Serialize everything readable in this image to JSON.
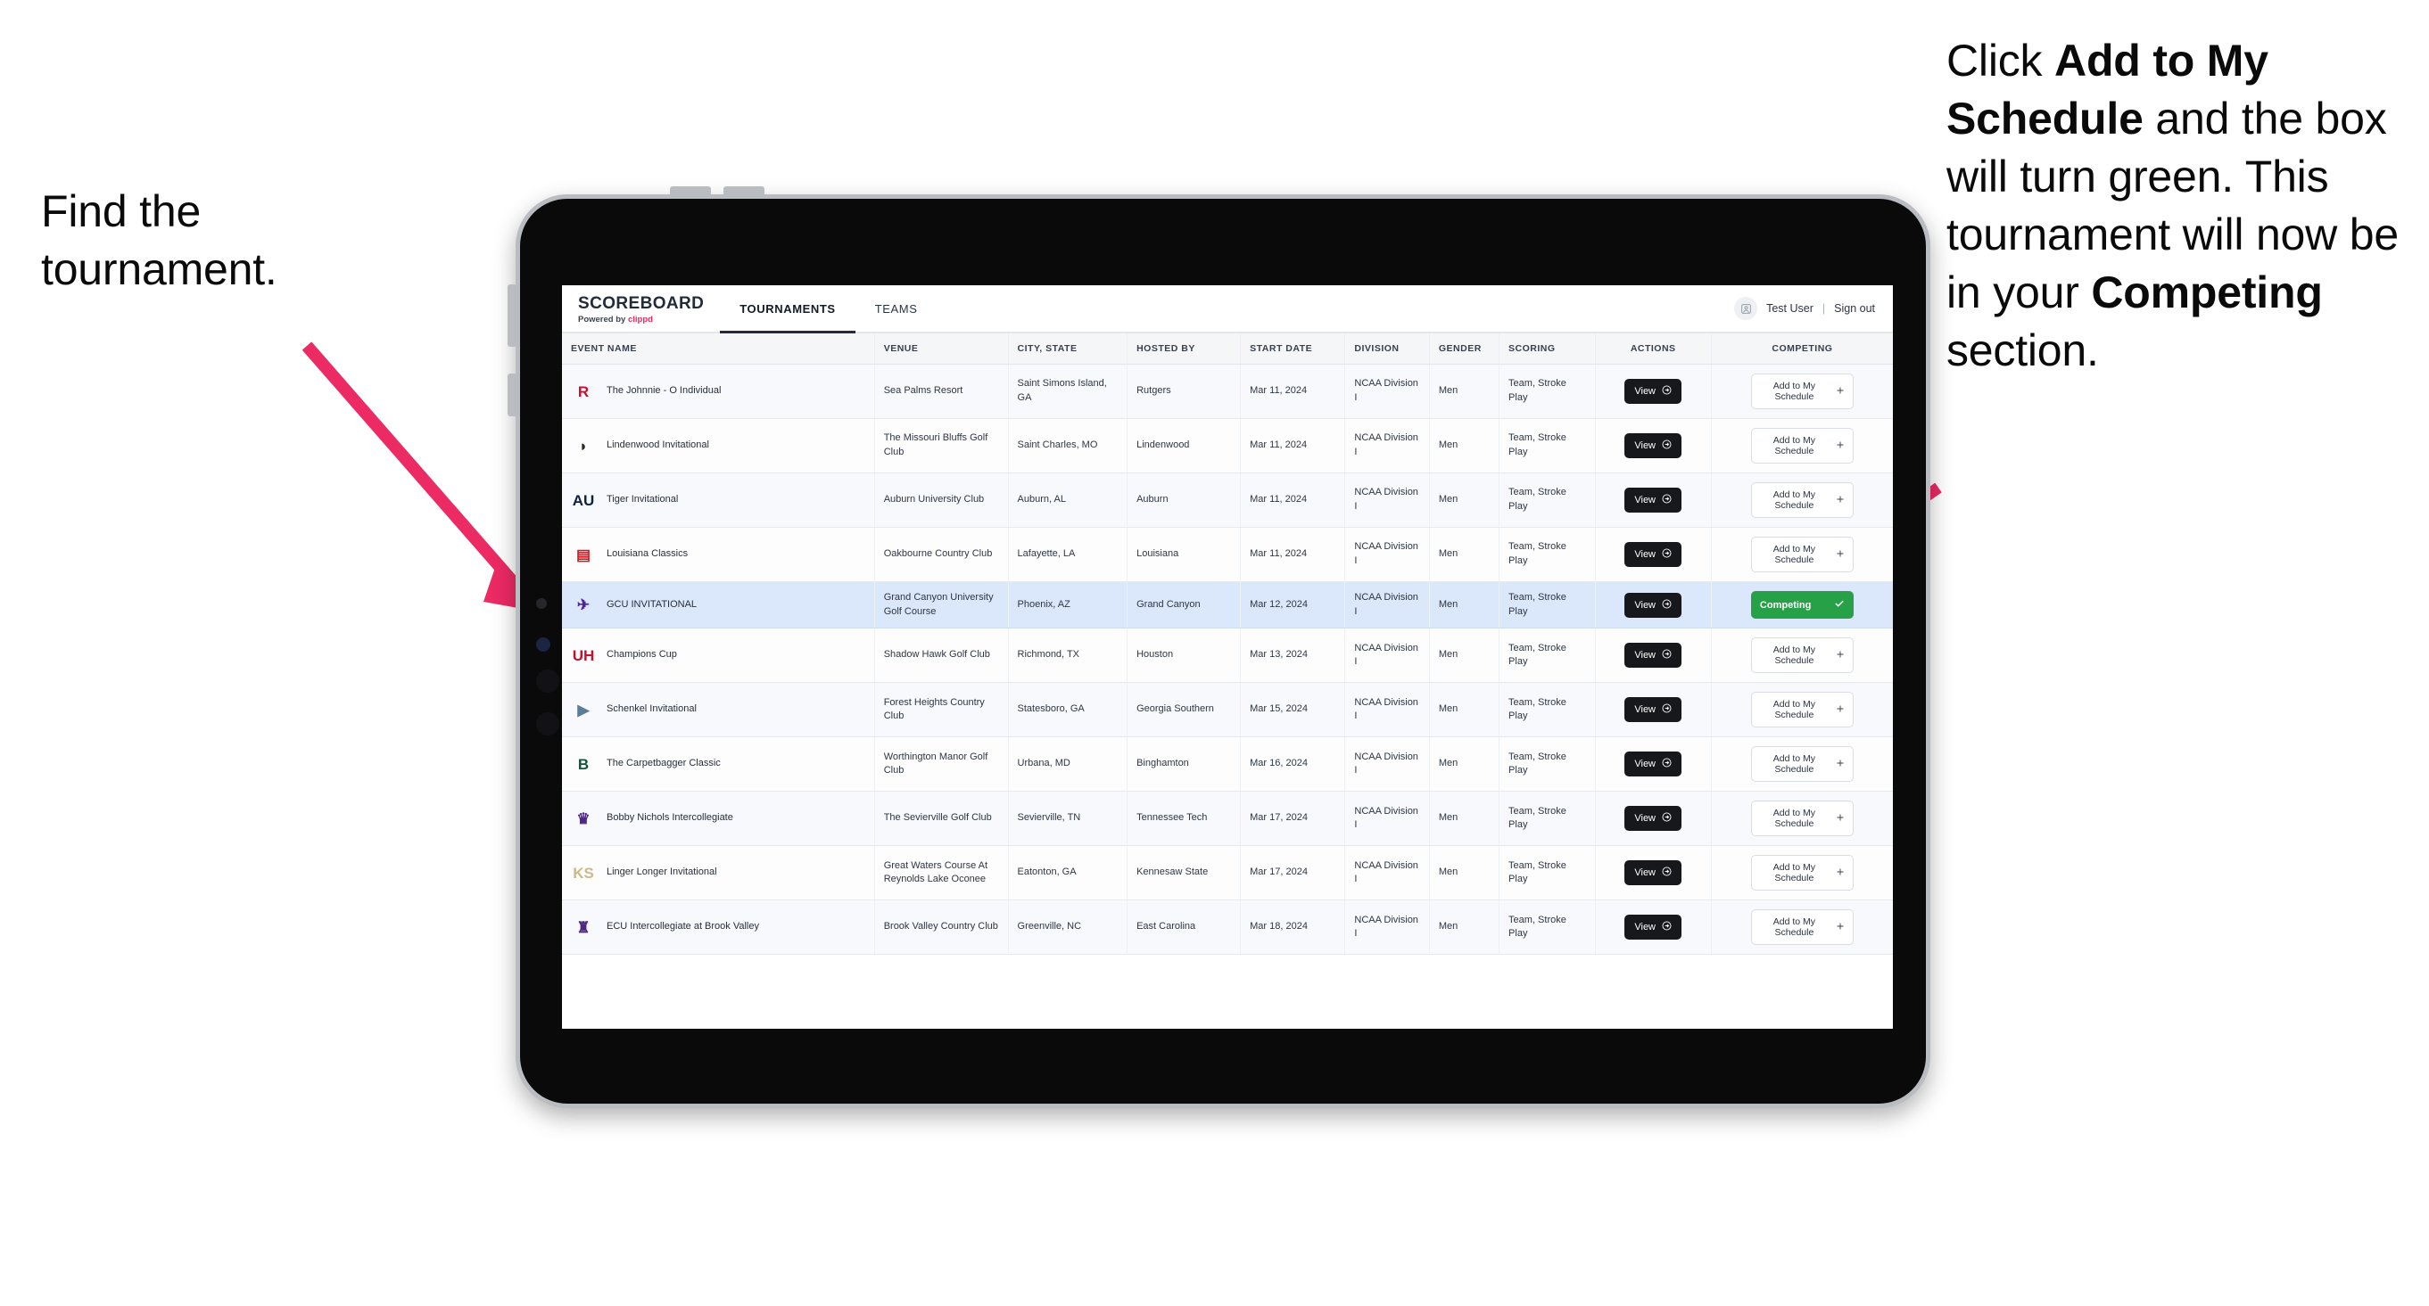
{
  "annotations": {
    "left": {
      "line1": "Find the",
      "line2": "tournament."
    },
    "right": {
      "pre": "Click ",
      "bold1": "Add to My Schedule",
      "mid": " and the box will turn green. This tournament will now be in your ",
      "bold2": "Competing",
      "post": " section."
    }
  },
  "colors": {
    "arrow": "#EC2A64",
    "competing_green": "#26A148",
    "brand_accent": "#F0275C",
    "selected_row": "#DBE7FB",
    "view_button": "#17181C"
  },
  "app": {
    "brand": {
      "name": "SCOREBOARD",
      "powered_prefix": "Powered by ",
      "powered_brand": "clippd"
    },
    "tabs": [
      {
        "label": "TOURNAMENTS",
        "active": true
      },
      {
        "label": "TEAMS",
        "active": false
      }
    ],
    "user": {
      "avatar_icon": "user-avatar-icon",
      "name": "Test User",
      "divider": "|",
      "sign_out": "Sign out"
    }
  },
  "table": {
    "columns": [
      "EVENT NAME",
      "VENUE",
      "CITY, STATE",
      "HOSTED BY",
      "START DATE",
      "DIVISION",
      "GENDER",
      "SCORING",
      "ACTIONS",
      "COMPETING"
    ],
    "view_label": "View",
    "add_label": "Add to My Schedule",
    "add_icon": "plus-icon",
    "view_icon": "arrow-circle-right-icon",
    "competing_label": "Competing",
    "competing_icon": "check-icon",
    "rows": [
      {
        "logo": "R",
        "logo_color": "#C8102E",
        "event": "The Johnnie - O Individual",
        "venue": "Sea Palms Resort",
        "city": "Saint Simons Island, GA",
        "host": "Rutgers",
        "date": "Mar 11, 2024",
        "division": "NCAA Division I",
        "gender": "Men",
        "scoring": "Team, Stroke Play",
        "competing": false
      },
      {
        "logo": "◗",
        "logo_color": "#2E2B25",
        "event": "Lindenwood Invitational",
        "venue": "The Missouri Bluffs Golf Club",
        "city": "Saint Charles, MO",
        "host": "Lindenwood",
        "date": "Mar 11, 2024",
        "division": "NCAA Division I",
        "gender": "Men",
        "scoring": "Team, Stroke Play",
        "competing": false
      },
      {
        "logo": "AU",
        "logo_color": "#0C2340",
        "event": "Tiger Invitational",
        "venue": "Auburn University Club",
        "city": "Auburn, AL",
        "host": "Auburn",
        "date": "Mar 11, 2024",
        "division": "NCAA Division I",
        "gender": "Men",
        "scoring": "Team, Stroke Play",
        "competing": false
      },
      {
        "logo": "▤",
        "logo_color": "#CE181E",
        "event": "Louisiana Classics",
        "venue": "Oakbourne Country Club",
        "city": "Lafayette, LA",
        "host": "Louisiana",
        "date": "Mar 11, 2024",
        "division": "NCAA Division I",
        "gender": "Men",
        "scoring": "Team, Stroke Play",
        "competing": false
      },
      {
        "logo": "✈",
        "logo_color": "#522398",
        "event": "GCU INVITATIONAL",
        "venue": "Grand Canyon University Golf Course",
        "city": "Phoenix, AZ",
        "host": "Grand Canyon",
        "date": "Mar 12, 2024",
        "division": "NCAA Division I",
        "gender": "Men",
        "scoring": "Team, Stroke Play",
        "competing": true,
        "selected": true
      },
      {
        "logo": "UH",
        "logo_color": "#C8102E",
        "event": "Champions Cup",
        "venue": "Shadow Hawk Golf Club",
        "city": "Richmond, TX",
        "host": "Houston",
        "date": "Mar 13, 2024",
        "division": "NCAA Division I",
        "gender": "Men",
        "scoring": "Team, Stroke Play",
        "competing": false
      },
      {
        "logo": "▶",
        "logo_color": "#5A7D9A",
        "event": "Schenkel Invitational",
        "venue": "Forest Heights Country Club",
        "city": "Statesboro, GA",
        "host": "Georgia Southern",
        "date": "Mar 15, 2024",
        "division": "NCAA Division I",
        "gender": "Men",
        "scoring": "Team, Stroke Play",
        "competing": false
      },
      {
        "logo": "B",
        "logo_color": "#115740",
        "event": "The Carpetbagger Classic",
        "venue": "Worthington Manor Golf Club",
        "city": "Urbana, MD",
        "host": "Binghamton",
        "date": "Mar 16, 2024",
        "division": "NCAA Division I",
        "gender": "Men",
        "scoring": "Team, Stroke Play",
        "competing": false
      },
      {
        "logo": "♛",
        "logo_color": "#4F2683",
        "event": "Bobby Nichols Intercollegiate",
        "venue": "The Sevierville Golf Club",
        "city": "Sevierville, TN",
        "host": "Tennessee Tech",
        "date": "Mar 17, 2024",
        "division": "NCAA Division I",
        "gender": "Men",
        "scoring": "Team, Stroke Play",
        "competing": false
      },
      {
        "logo": "KS",
        "logo_color": "#CEB888",
        "event": "Linger Longer Invitational",
        "venue": "Great Waters Course At Reynolds Lake Oconee",
        "city": "Eatonton, GA",
        "host": "Kennesaw State",
        "date": "Mar 17, 2024",
        "division": "NCAA Division I",
        "gender": "Men",
        "scoring": "Team, Stroke Play",
        "competing": false
      },
      {
        "logo": "♜",
        "logo_color": "#4F2683",
        "event": "ECU Intercollegiate at Brook Valley",
        "venue": "Brook Valley Country Club",
        "city": "Greenville, NC",
        "host": "East Carolina",
        "date": "Mar 18, 2024",
        "division": "NCAA Division I",
        "gender": "Men",
        "scoring": "Team, Stroke Play",
        "competing": false,
        "clipped": true
      }
    ]
  }
}
